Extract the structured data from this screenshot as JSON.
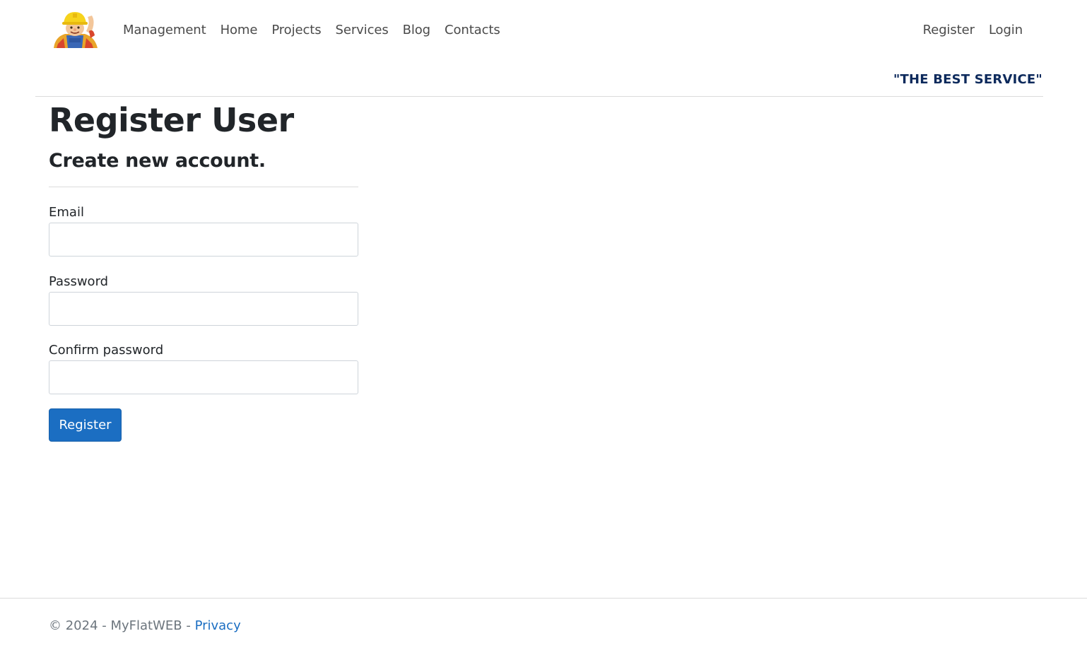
{
  "header": {
    "logo_name": "builder-mascot-logo",
    "nav": [
      "Management",
      "Home",
      "Projects",
      "Services",
      "Blog",
      "Contacts"
    ],
    "auth": [
      "Register",
      "Login"
    ],
    "slogan": "\"THE BEST SERVICE\""
  },
  "main": {
    "title": "Register User",
    "subtitle": "Create new account.",
    "fields": [
      {
        "label": "Email",
        "value": ""
      },
      {
        "label": "Password",
        "value": ""
      },
      {
        "label": "Confirm password",
        "value": ""
      }
    ],
    "submit_label": "Register"
  },
  "footer": {
    "copyright": "© 2024 - MyFlatWEB - ",
    "privacy_label": "Privacy"
  },
  "colors": {
    "primary": "#1b6ec2",
    "slogan": "#0d2a5c",
    "text": "#212529",
    "muted": "#6c757d"
  }
}
